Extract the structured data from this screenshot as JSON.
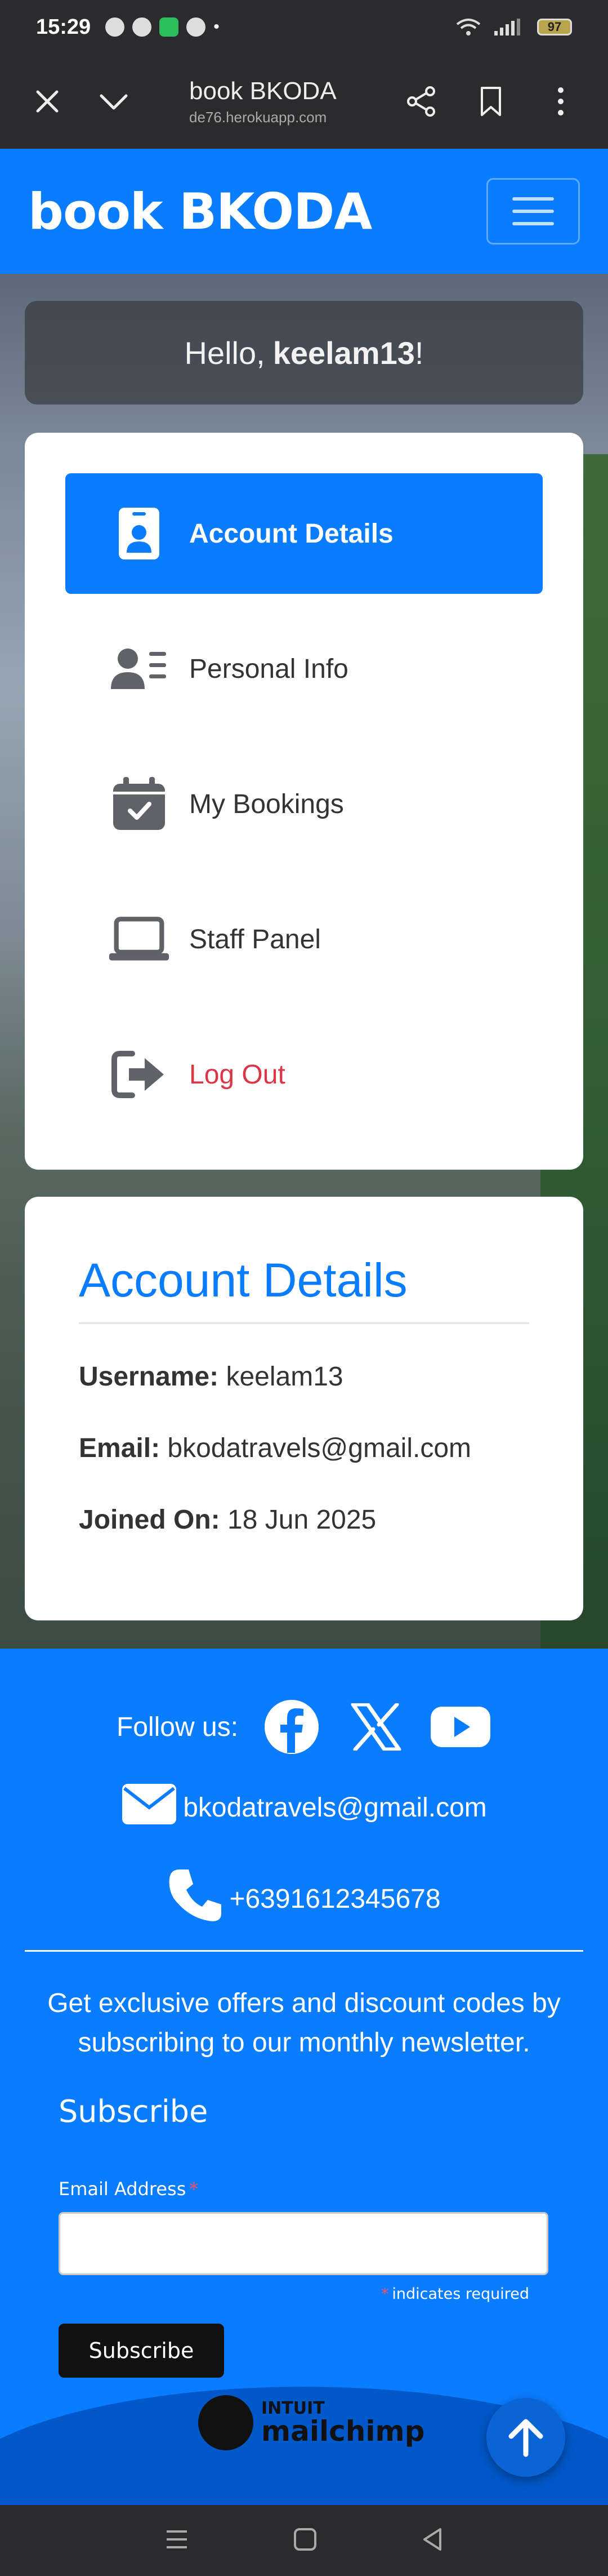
{
  "status_bar": {
    "time": "15:29",
    "battery": "97"
  },
  "browser": {
    "title": "book BKODA",
    "url": "de76.herokuapp.com"
  },
  "navbar": {
    "brand": "book BKODA"
  },
  "greeting": {
    "prefix": "Hello,",
    "username": "keelam13",
    "suffix": "!"
  },
  "menu": {
    "items": [
      {
        "label": "Account Details",
        "icon": "id-badge-icon",
        "active": true
      },
      {
        "label": "Personal Info",
        "icon": "user-lines-icon",
        "active": false
      },
      {
        "label": "My Bookings",
        "icon": "calendar-check-icon",
        "active": false
      },
      {
        "label": "Staff Panel",
        "icon": "laptop-icon",
        "active": false
      },
      {
        "label": "Log Out",
        "icon": "logout-icon",
        "active": false
      }
    ]
  },
  "account": {
    "heading": "Account Details",
    "username_label": "Username:",
    "username": "keelam13",
    "email_label": "Email:",
    "email": "bkodatravels@gmail.com",
    "joined_label": "Joined On:",
    "joined": "18 Jun 2025"
  },
  "footer": {
    "follow_label": "Follow us:",
    "email": "bkodatravels@gmail.com",
    "phone": "+6391612345678",
    "newsletter_text": "Get exclusive offers and discount codes by subscribing to our monthly newsletter.",
    "subscribe_heading": "Subscribe",
    "email_field_label": "Email Address",
    "required_star": "*",
    "indicates_required": "indicates required",
    "subscribe_button": "Subscribe",
    "mailchimp_top": "INTUIT",
    "mailchimp_bottom": "mailchimp"
  },
  "colors": {
    "primary": "#0a7cff",
    "danger": "#dc3545"
  }
}
